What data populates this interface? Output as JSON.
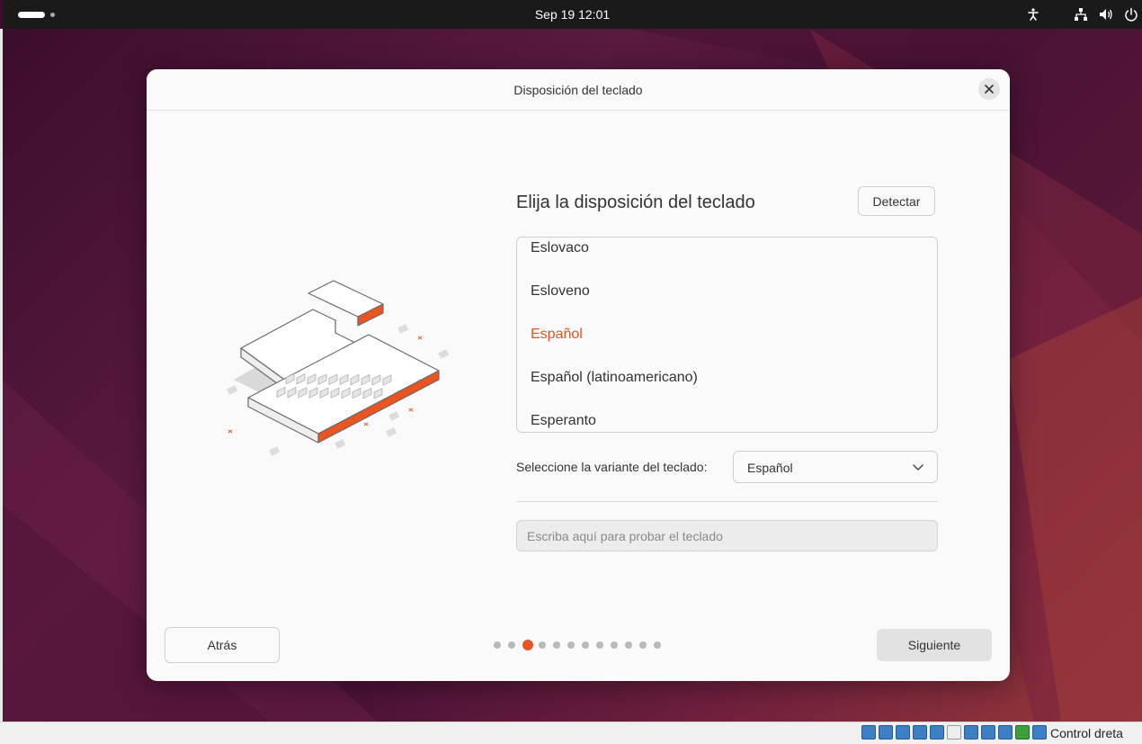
{
  "topbar": {
    "clock": "Sep 19  12:01",
    "tray_icons": [
      "accessibility-icon",
      "network-icon",
      "volume-icon",
      "power-icon"
    ]
  },
  "dialog": {
    "title": "Disposición del teclado",
    "heading": "Elija la disposición del teclado",
    "detect_label": "Detectar",
    "layouts": [
      {
        "label": "Eslovaco",
        "selected": false
      },
      {
        "label": "Esloveno",
        "selected": false
      },
      {
        "label": "Español",
        "selected": true
      },
      {
        "label": "Español (latinoamericano)",
        "selected": false
      },
      {
        "label": "Esperanto",
        "selected": false
      }
    ],
    "variant_label": "Seleccione la variante del teclado:",
    "variant_value": "Español",
    "test_placeholder": "Escriba aquí para probar el teclado",
    "back_label": "Atrás",
    "next_label": "Siguiente",
    "pager": {
      "total": 12,
      "current": 3
    }
  },
  "statusbar": {
    "host_key": "Control dreta"
  },
  "colors": {
    "accent": "#e95420",
    "topbar": "#1a1a1a",
    "dialog_bg": "#fafafa"
  }
}
